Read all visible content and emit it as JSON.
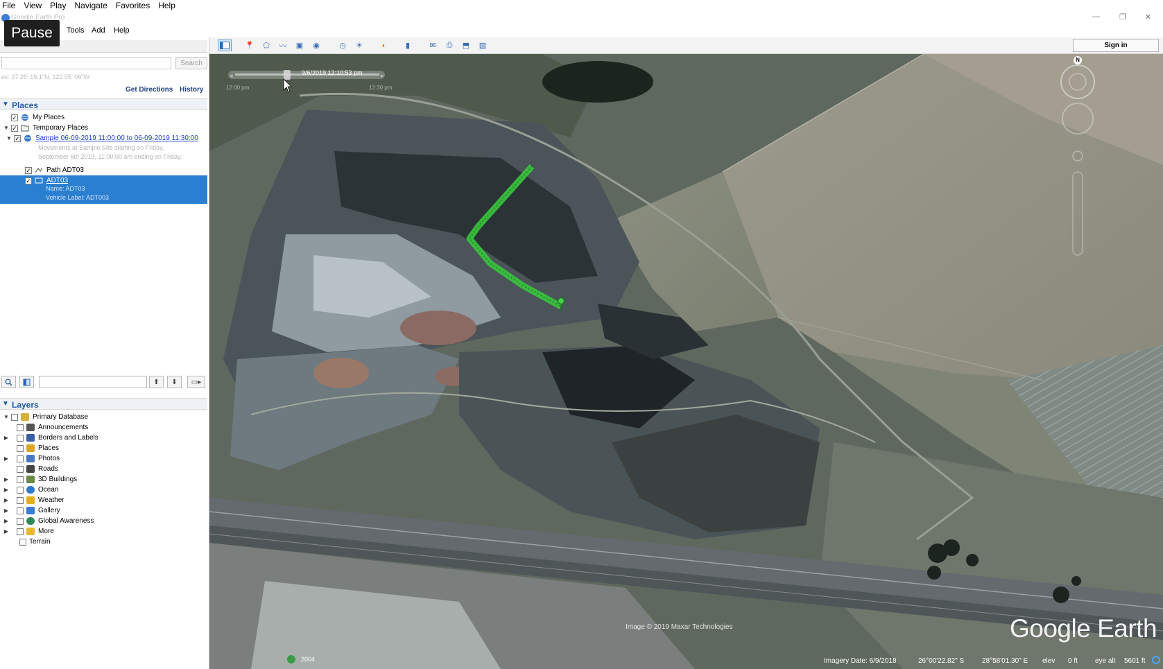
{
  "outer_menu": [
    "File",
    "View",
    "Play",
    "Navigate",
    "Favorites",
    "Help"
  ],
  "window_title": "Google Earth Pro",
  "overlay": {
    "pause_label": "Pause"
  },
  "app_menu": [
    "Tools",
    "Add",
    "Help"
  ],
  "search": {
    "header": "Search",
    "input_value": "",
    "button_label": "Search",
    "coords_hint": "ex: 37 25' 19.1\"N, 122 05' 06\"W",
    "get_directions": "Get Directions",
    "history": "History"
  },
  "places": {
    "header": "Places",
    "my_places": "My Places",
    "temporary_places": "Temporary Places",
    "sample_link": "Sample 06-09-2019 11:00:00 to 06-09-2019 11:30:00",
    "sample_desc1": "Movements at Sample Site starting on Friday,",
    "sample_desc2": "September 6th 2019, 11:00:00 am ending on Friday,",
    "path_label": "Path ADT03",
    "adt_link": "ADT03",
    "adt_name": "Name: ADT03",
    "adt_vehicle": "Vehicle Label: ADT003"
  },
  "layers": {
    "header": "Layers",
    "items": [
      {
        "label": "Primary Database",
        "icon": "database-icon",
        "expandable": false,
        "checked": false
      },
      {
        "label": "Announcements",
        "icon": "envelope-icon",
        "expandable": false,
        "checked": false
      },
      {
        "label": "Borders and Labels",
        "icon": "flag-icon",
        "expandable": true,
        "checked": false
      },
      {
        "label": "Places",
        "icon": "places-icon",
        "expandable": false,
        "checked": false
      },
      {
        "label": "Photos",
        "icon": "photo-icon",
        "expandable": true,
        "checked": false
      },
      {
        "label": "Roads",
        "icon": "road-icon",
        "expandable": false,
        "checked": false
      },
      {
        "label": "3D Buildings",
        "icon": "building-icon",
        "expandable": true,
        "checked": false
      },
      {
        "label": "Ocean",
        "icon": "ocean-icon",
        "expandable": true,
        "checked": false
      },
      {
        "label": "Weather",
        "icon": "weather-icon",
        "expandable": true,
        "checked": false
      },
      {
        "label": "Gallery",
        "icon": "gallery-icon",
        "expandable": true,
        "checked": false
      },
      {
        "label": "Global Awareness",
        "icon": "globe-icon",
        "expandable": true,
        "checked": false
      },
      {
        "label": "More",
        "icon": "more-icon",
        "expandable": true,
        "checked": false
      },
      {
        "label": "Terrain",
        "icon": "",
        "expandable": false,
        "checked": false
      }
    ]
  },
  "toolbar": {
    "sign_in": "Sign in"
  },
  "map": {
    "time_slider_date": "9/6/2019  12:10:53 pm",
    "time_start": "12:00 pm",
    "time_end": "12:30 pm",
    "time_position": 0.36,
    "watermark": "Google Earth",
    "copyright": "Image © 2019 Maxar Technologies",
    "year": "2004",
    "imagery_date": "Imagery Date: 6/9/2018",
    "lat": "26°00'22.82\" S",
    "lon": "28°58'01.30\" E",
    "elev_label": "elev",
    "elev_value": "0 ft",
    "eye_alt_label": "eye alt",
    "eye_alt_value": "5601 ft",
    "track_color": "#35c43a",
    "compass_label": "N"
  }
}
